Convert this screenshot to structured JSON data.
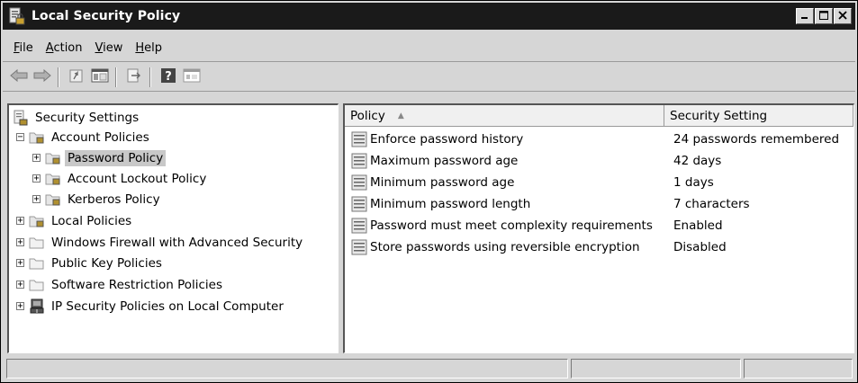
{
  "window": {
    "title": "Local Security Policy",
    "controls": [
      "minimize-icon",
      "maximize-icon",
      "close-icon"
    ]
  },
  "menu": {
    "file": {
      "underline": "F",
      "rest": "ile"
    },
    "action": {
      "underline": "A",
      "rest": "ction"
    },
    "view": {
      "underline": "V",
      "rest": "iew"
    },
    "help": {
      "underline": "H",
      "rest": "elp"
    }
  },
  "toolbar": {
    "buttons": [
      "back-arrow-icon",
      "forward-arrow-icon",
      "up-folder-icon",
      "show-hide-tree-icon",
      "export-list-icon",
      "help-icon",
      "properties-icon"
    ]
  },
  "tree": {
    "items": [
      {
        "label": "Security Settings"
      },
      {
        "label": "Account Policies"
      },
      {
        "label": "Password Policy"
      },
      {
        "label": "Account Lockout Policy"
      },
      {
        "label": "Kerberos Policy"
      },
      {
        "label": "Local Policies"
      },
      {
        "label": "Windows Firewall with Advanced Security"
      },
      {
        "label": "Public Key Policies"
      },
      {
        "label": "Software Restriction Policies"
      },
      {
        "label": "IP Security Policies on Local Computer"
      }
    ],
    "selected": "Password Policy"
  },
  "list": {
    "columns": {
      "policy": "Policy",
      "setting": "Security Setting"
    },
    "sort_indicator": "▲",
    "rows": [
      {
        "policy": "Enforce password history",
        "setting": "24 passwords remembered"
      },
      {
        "policy": "Maximum password age",
        "setting": "42 days"
      },
      {
        "policy": "Minimum password age",
        "setting": "1 days"
      },
      {
        "policy": "Minimum password length",
        "setting": "7 characters"
      },
      {
        "policy": "Password must meet complexity requirements",
        "setting": "Enabled"
      },
      {
        "policy": "Store passwords using reversible encryption",
        "setting": "Disabled"
      }
    ]
  },
  "statusbar": {
    "cells": [
      "",
      "",
      ""
    ]
  }
}
